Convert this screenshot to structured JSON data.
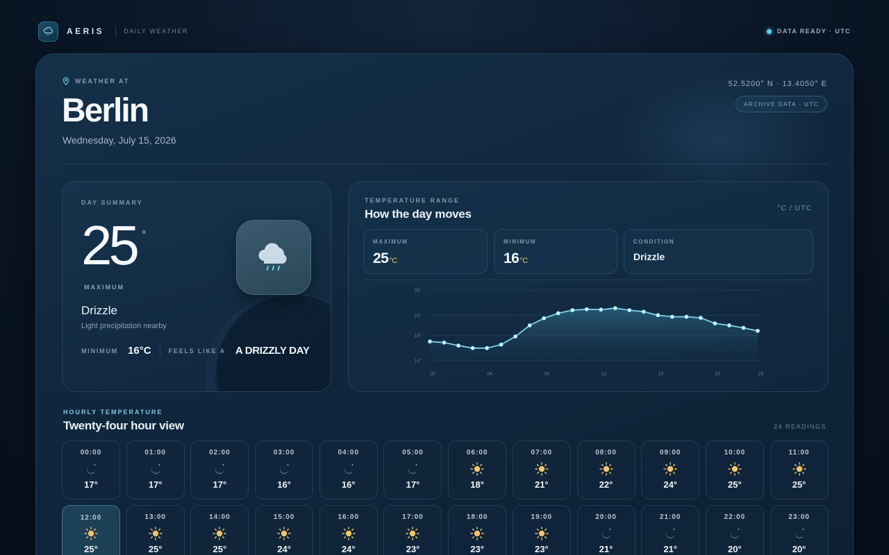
{
  "brand": {
    "name": "AERIS",
    "subtitle": "DAILY WEATHER",
    "status": "DATA READY · UTC"
  },
  "location": {
    "label": "WEATHER AT",
    "city": "Berlin",
    "date": "Wednesday, July 15, 2026",
    "coords": "52.5200° N · 13.4050° E",
    "archive": "ARCHIVE DATA · UTC"
  },
  "summary": {
    "label": "DAY SUMMARY",
    "temp": "25",
    "deg": "°",
    "temp_label": "MAXIMUM",
    "condition": "Drizzle",
    "description": "Light precipitation nearby",
    "min_label": "MINIMUM",
    "min_value": "16°C",
    "feels_label": "FEELS LIKE A",
    "feels_value": "A DRIZZLY DAY",
    "icon": "cloud-drizzle-icon"
  },
  "range": {
    "label": "TEMPERATURE RANGE",
    "title": "How the day moves",
    "unit": "°C / UTC",
    "max_label": "MAXIMUM",
    "max_value": "25",
    "max_unit": "°C",
    "min_label": "MINIMUM",
    "min_value": "16",
    "min_unit": "°C",
    "cond_label": "CONDITION",
    "cond_value": "Drizzle"
  },
  "chart_data": {
    "type": "area",
    "title": "",
    "xlabel": "",
    "ylabel": "",
    "x": [
      0,
      1,
      2,
      3,
      4,
      5,
      6,
      7,
      8,
      9,
      10,
      11,
      12,
      13,
      14,
      15,
      16,
      17,
      18,
      19,
      20,
      21,
      22,
      23
    ],
    "x_tick_labels": [
      "00",
      "04",
      "08",
      "12",
      "16",
      "20",
      "23"
    ],
    "x_ticks": [
      0,
      4,
      8,
      12,
      16,
      20,
      23
    ],
    "y_tick_labels": [
      "14°",
      "19°",
      "23°",
      "28°"
    ],
    "y_ticks": [
      14,
      19,
      23,
      28
    ],
    "ylim": [
      14,
      28
    ],
    "series": [
      {
        "values": [
          17.8,
          17.6,
          17.0,
          16.5,
          16.5,
          17.2,
          18.8,
          21.0,
          22.4,
          23.4,
          24.0,
          24.2,
          24.1,
          24.4,
          24.0,
          23.7,
          23.0,
          22.7,
          22.7,
          22.5,
          21.4,
          21.0,
          20.5,
          19.9
        ]
      }
    ],
    "grid": true,
    "colors": {
      "line": "#7fd3ea",
      "marker": "#dff5fb"
    }
  },
  "hourly": {
    "label": "HOURLY TEMPERATURE",
    "title": "Twenty-four hour view",
    "count": "24 READINGS",
    "items": [
      {
        "time": "00:00",
        "icon": "moon-icon",
        "temp": "17°"
      },
      {
        "time": "01:00",
        "icon": "moon-icon",
        "temp": "17°"
      },
      {
        "time": "02:00",
        "icon": "moon-icon",
        "temp": "17°"
      },
      {
        "time": "03:00",
        "icon": "moon-icon",
        "temp": "16°"
      },
      {
        "time": "04:00",
        "icon": "moon-icon",
        "temp": "16°"
      },
      {
        "time": "05:00",
        "icon": "moon-icon",
        "temp": "17°"
      },
      {
        "time": "06:00",
        "icon": "sun-icon",
        "temp": "18°"
      },
      {
        "time": "07:00",
        "icon": "sun-icon",
        "temp": "21°"
      },
      {
        "time": "08:00",
        "icon": "sun-icon",
        "temp": "22°"
      },
      {
        "time": "09:00",
        "icon": "sun-icon",
        "temp": "24°"
      },
      {
        "time": "10:00",
        "icon": "sun-icon",
        "temp": "25°"
      },
      {
        "time": "11:00",
        "icon": "sun-icon",
        "temp": "25°"
      },
      {
        "time": "12:00",
        "icon": "sun-icon",
        "temp": "25°",
        "active": true
      },
      {
        "time": "13:00",
        "icon": "sun-icon",
        "temp": "25°"
      },
      {
        "time": "14:00",
        "icon": "sun-icon",
        "temp": "25°"
      },
      {
        "time": "15:00",
        "icon": "sun-icon",
        "temp": "24°"
      },
      {
        "time": "16:00",
        "icon": "sun-icon",
        "temp": "24°"
      },
      {
        "time": "17:00",
        "icon": "sun-icon",
        "temp": "23°"
      },
      {
        "time": "18:00",
        "icon": "sun-icon",
        "temp": "23°"
      },
      {
        "time": "19:00",
        "icon": "sun-icon",
        "temp": "23°"
      },
      {
        "time": "20:00",
        "icon": "moon-icon",
        "temp": "21°"
      },
      {
        "time": "21:00",
        "icon": "moon-icon",
        "temp": "21°"
      },
      {
        "time": "22:00",
        "icon": "moon-icon",
        "temp": "20°"
      },
      {
        "time": "23:00",
        "icon": "moon-icon",
        "temp": "20°"
      }
    ]
  },
  "colors": {
    "accent": "#5fd0ea",
    "warm": "#f2c46b",
    "background": "#0a1626"
  }
}
